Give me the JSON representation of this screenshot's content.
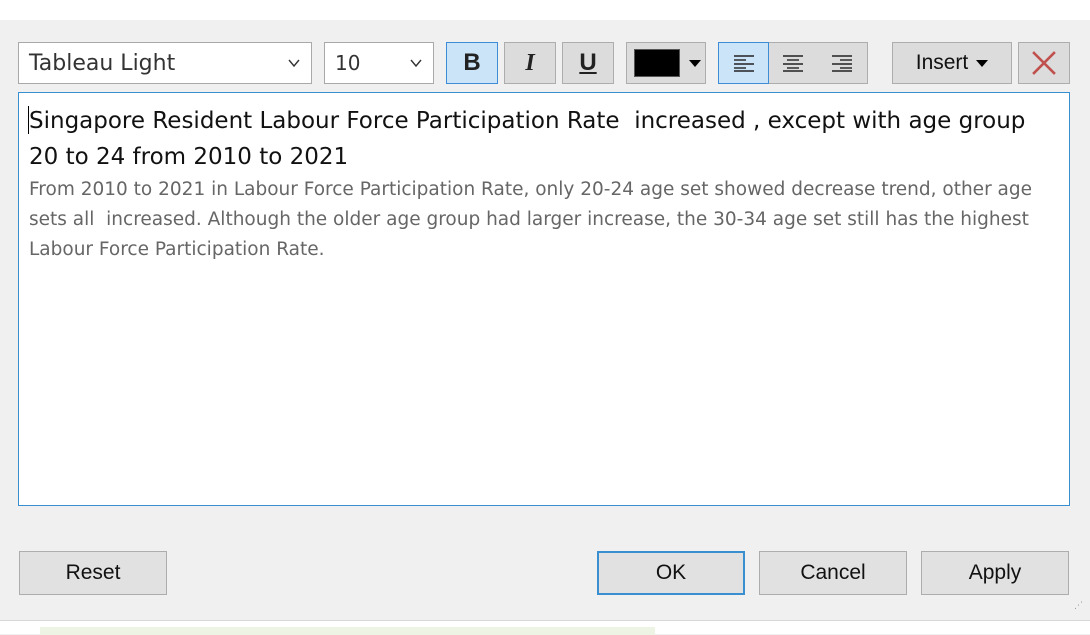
{
  "toolbar": {
    "font_family": "Tableau Light",
    "font_size": "10",
    "bold_label": "B",
    "italic_label": "I",
    "underline_label": "U",
    "text_color": "#000000",
    "bold_active": true,
    "alignment": "left",
    "insert_label": "Insert",
    "icons": [
      "chevron-down-icon",
      "align-left-icon",
      "align-center-icon",
      "align-right-icon",
      "clear-x-icon"
    ]
  },
  "editor": {
    "headline": "Singapore Resident Labour Force Participation Rate  increased , except with age group 20 to 24 from 2010 to 2021",
    "body": "From 2010 to 2021 in Labour Force Participation Rate, only 20-24 age set showed decrease trend, other age sets all  increased. Although the older age group had larger increase, the 30-34 age set still has the highest Labour Force Participation Rate."
  },
  "buttons": {
    "reset": "Reset",
    "ok": "OK",
    "cancel": "Cancel",
    "apply": "Apply"
  },
  "colors": {
    "accent": "#3a8fd0",
    "active_fill": "#cce4f7",
    "clear_icon": "#c0504d"
  }
}
